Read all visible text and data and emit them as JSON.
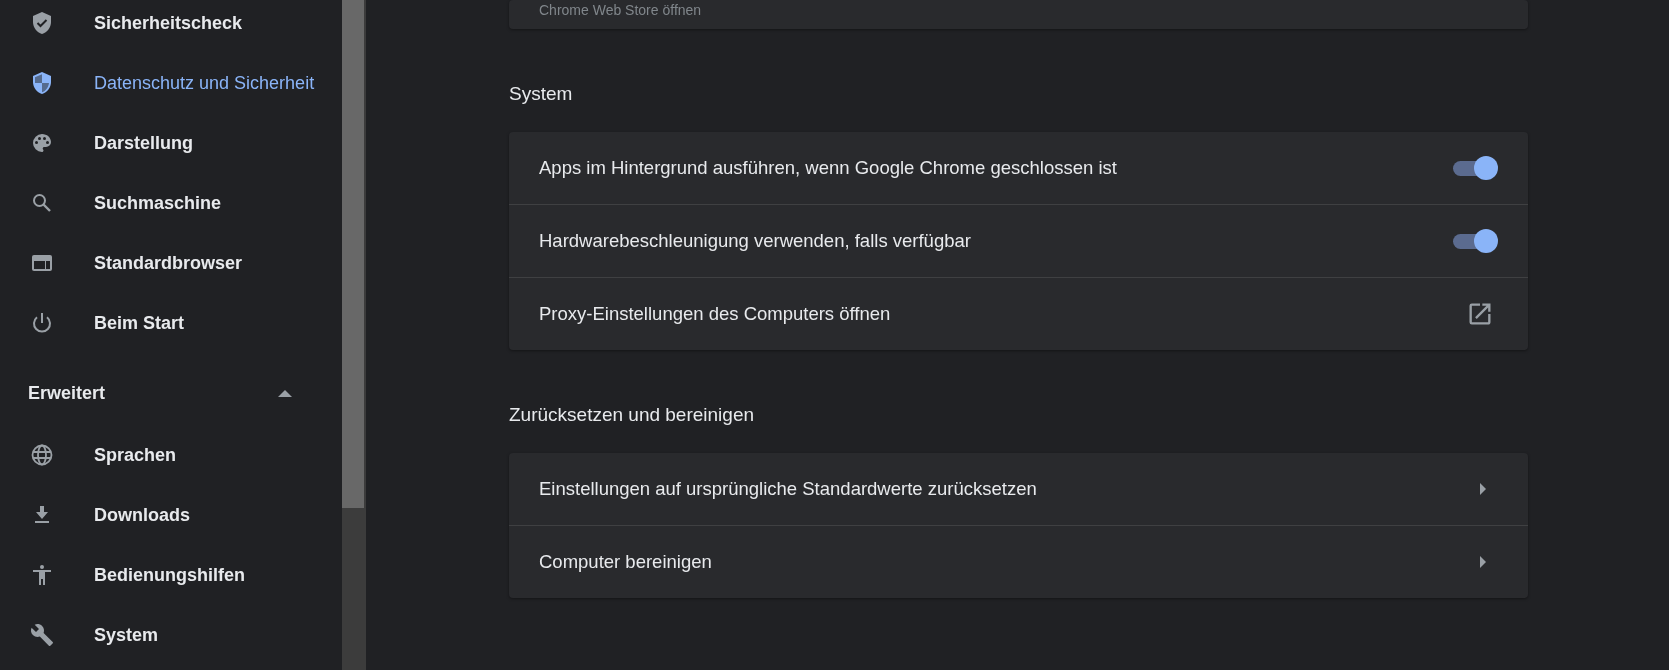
{
  "sidebar": {
    "items": [
      {
        "label": "Sicherheitscheck",
        "selected": false
      },
      {
        "label": "Datenschutz und Sicherheit",
        "selected": true
      },
      {
        "label": "Darstellung",
        "selected": false
      },
      {
        "label": "Suchmaschine",
        "selected": false
      },
      {
        "label": "Standardbrowser",
        "selected": false
      },
      {
        "label": "Beim Start",
        "selected": false
      }
    ],
    "advanced": {
      "label": "Erweitert",
      "expanded": true
    },
    "advanced_items": [
      {
        "label": "Sprachen",
        "selected": false
      },
      {
        "label": "Downloads",
        "selected": false
      },
      {
        "label": "Bedienungshilfen",
        "selected": false
      },
      {
        "label": "System",
        "selected": false
      }
    ]
  },
  "top_card": {
    "label": "Chrome Web Store öffnen"
  },
  "sections": [
    {
      "title": "System",
      "rows": [
        {
          "kind": "toggle",
          "label": "Apps im Hintergrund ausführen, wenn Google Chrome geschlossen ist",
          "on": true
        },
        {
          "kind": "toggle",
          "label": "Hardwarebeschleunigung verwenden, falls verfügbar",
          "on": true
        },
        {
          "kind": "external",
          "label": "Proxy-Einstellungen des Computers öffnen"
        }
      ]
    },
    {
      "title": "Zurücksetzen und bereinigen",
      "rows": [
        {
          "kind": "arrow",
          "label": "Einstellungen auf ursprüngliche Standardwerte zurücksetzen"
        },
        {
          "kind": "arrow",
          "label": "Computer bereinigen"
        }
      ]
    }
  ]
}
